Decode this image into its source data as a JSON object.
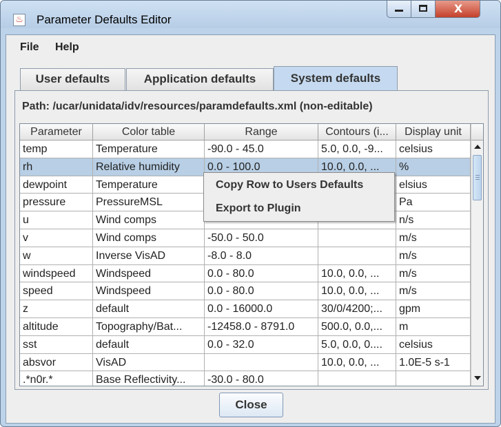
{
  "window": {
    "title": "Parameter Defaults Editor",
    "app_icon_glyph": "♨",
    "close_glyph": "X"
  },
  "menubar": {
    "file": "File",
    "help": "Help"
  },
  "tabs": [
    {
      "label": "User defaults",
      "selected": false
    },
    {
      "label": "Application defaults",
      "selected": false
    },
    {
      "label": "System defaults",
      "selected": true
    }
  ],
  "path_label": "Path: /ucar/unidata/idv/resources/paramdefaults.xml (non-editable)",
  "table": {
    "columns": [
      "Parameter",
      "Color table",
      "Range",
      "Contours (i...",
      "Display unit"
    ],
    "rows": [
      [
        "temp",
        "Temperature",
        "-90.0 - 45.0",
        "5.0, 0.0, -9...",
        "celsius"
      ],
      [
        "rh",
        "Relative humidity",
        "0.0 - 100.0",
        "10.0, 0.0, ...",
        "%"
      ],
      [
        "dewpoint",
        "Temperature",
        "",
        "",
        "elsius"
      ],
      [
        "pressure",
        "PressureMSL",
        "",
        "",
        "Pa"
      ],
      [
        "u",
        "Wind comps",
        "",
        "",
        "n/s"
      ],
      [
        "v",
        "Wind comps",
        "-50.0 - 50.0",
        "",
        "m/s"
      ],
      [
        "w",
        "Inverse VisAD",
        "-8.0 - 8.0",
        "",
        "m/s"
      ],
      [
        "windspeed",
        "Windspeed",
        "0.0 - 80.0",
        "10.0, 0.0, ...",
        "m/s"
      ],
      [
        "speed",
        "Windspeed",
        "0.0 - 80.0",
        "10.0, 0.0, ...",
        "m/s"
      ],
      [
        "z",
        "default",
        "0.0 - 16000.0",
        "30/0/4200;...",
        "gpm"
      ],
      [
        "altitude",
        "Topography/Bat...",
        "-12458.0 - 8791.0",
        "500.0, 0.0,...",
        "m"
      ],
      [
        "sst",
        "default",
        "0.0 - 32.0",
        "5.0, 0.0, 0....",
        "celsius"
      ],
      [
        "absvor",
        "VisAD",
        "",
        "10.0, 0.0, ...",
        "1.0E-5 s-1"
      ],
      [
        ".*n0r.*",
        "Base Reflectivity...",
        "-30.0 - 80.0",
        "",
        ""
      ]
    ],
    "selected_row": 1
  },
  "context_menu": {
    "items": [
      "Copy Row to Users Defaults",
      "Export to Plugin"
    ]
  },
  "close_button": "Close"
}
